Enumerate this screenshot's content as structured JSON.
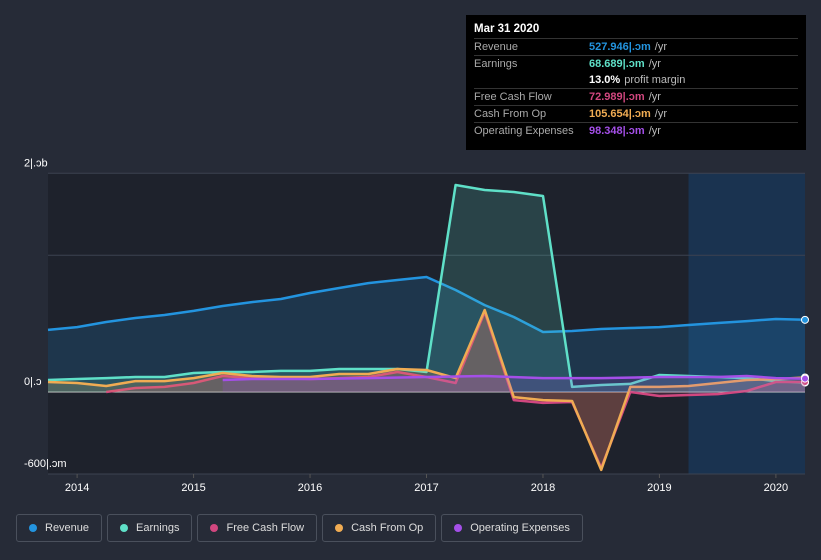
{
  "tooltip": {
    "date": "Mar 31 2020",
    "rows": [
      {
        "label": "Revenue",
        "value": "527.946|.ɔm",
        "unit": "/yr",
        "color": "#2394df"
      },
      {
        "label": "Earnings",
        "value": "68.689|.ɔm",
        "unit": "/yr",
        "color": "#5fe0c8"
      },
      {
        "label": "",
        "value": "13.0%",
        "unit": "profit margin",
        "color": "#ffffff"
      },
      {
        "label": "Free Cash Flow",
        "value": "72.989|.ɔm",
        "unit": "/yr",
        "color": "#d1477f"
      },
      {
        "label": "Cash From Op",
        "value": "105.654|.ɔm",
        "unit": "/yr",
        "color": "#f0ac53"
      },
      {
        "label": "Operating Expenses",
        "value": "98.348|.ɔm",
        "unit": "/yr",
        "color": "#a44fe8"
      }
    ]
  },
  "chart_data": {
    "type": "area",
    "ylim": [
      -600,
      1600
    ],
    "xlim": [
      2013.75,
      2020.25
    ],
    "forecast_region_start": 2019.25,
    "y_ticks": [
      {
        "value": 1600,
        "label": "2|.ɔb"
      },
      {
        "value": 1000,
        "label": ""
      },
      {
        "value": 0,
        "label": "0|.ɔ"
      },
      {
        "value": -600,
        "label": "-600|.ɔm"
      }
    ],
    "x_ticks": [
      2014,
      2015,
      2016,
      2017,
      2018,
      2019,
      2020
    ],
    "x_tick_labels": [
      "2014",
      "2015",
      "2016",
      "2017",
      "2018",
      "2019",
      "2020"
    ],
    "series": [
      {
        "name": "Revenue",
        "color": "#2394df",
        "x": [
          2013.75,
          2014,
          2014.25,
          2014.5,
          2014.75,
          2015,
          2015.25,
          2015.5,
          2015.75,
          2016,
          2016.25,
          2016.5,
          2016.75,
          2017,
          2017.25,
          2017.5,
          2017.75,
          2018,
          2018.25,
          2018.5,
          2018.75,
          2019,
          2019.25,
          2019.5,
          2019.75,
          2020,
          2020.25
        ],
        "values": [
          454,
          475,
          512,
          541,
          563,
          593,
          629,
          658,
          680,
          724,
          761,
          797,
          819,
          841,
          746,
          636,
          549,
          439,
          446,
          461,
          468,
          475,
          490,
          505,
          519,
          534,
          528
        ]
      },
      {
        "name": "Earnings",
        "color": "#5fe0c8",
        "x": [
          2013.75,
          2014,
          2014.25,
          2014.5,
          2014.75,
          2015,
          2015.25,
          2015.5,
          2015.75,
          2016,
          2016.25,
          2016.5,
          2016.75,
          2017,
          2017.25,
          2017.5,
          2017.75,
          2018,
          2018.25,
          2018.5,
          2018.75,
          2019,
          2019.25,
          2019.5,
          2019.75,
          2020,
          2020.25
        ],
        "values": [
          88,
          95,
          102,
          110,
          110,
          139,
          146,
          146,
          154,
          154,
          168,
          168,
          168,
          146,
          1514,
          1478,
          1463,
          1434,
          37,
          51,
          59,
          124,
          117,
          110,
          102,
          80,
          69
        ]
      },
      {
        "name": "Free Cash Flow",
        "color": "#d1477f",
        "x": [
          2014.25,
          2014.5,
          2014.75,
          2015,
          2015.25,
          2015.5,
          2015.75,
          2016,
          2016.25,
          2016.5,
          2016.75,
          2017,
          2017.25,
          2017.5,
          2017.75,
          2018,
          2018.25,
          2018.5,
          2018.75,
          2019,
          2019.25,
          2019.5,
          2019.75,
          2020,
          2020.25
        ],
        "values": [
          0,
          29,
          37,
          66,
          117,
          102,
          102,
          95,
          102,
          110,
          146,
          110,
          66,
          585,
          -59,
          -80,
          -73,
          -556,
          0,
          -29,
          -22,
          -15,
          7,
          73,
          73
        ]
      },
      {
        "name": "Cash From Op",
        "color": "#f0ac53",
        "x": [
          2013.75,
          2014,
          2014.25,
          2014.5,
          2014.75,
          2015,
          2015.25,
          2015.5,
          2015.75,
          2016,
          2016.25,
          2016.5,
          2016.75,
          2017,
          2017.25,
          2017.5,
          2017.75,
          2018,
          2018.25,
          2018.5,
          2018.75,
          2019,
          2019.25,
          2019.5,
          2019.75,
          2020,
          2020.25
        ],
        "values": [
          73,
          66,
          44,
          80,
          80,
          102,
          139,
          117,
          110,
          110,
          132,
          132,
          168,
          161,
          102,
          600,
          -37,
          -59,
          -66,
          -570,
          37,
          37,
          44,
          66,
          88,
          95,
          106
        ]
      },
      {
        "name": "Operating Expenses",
        "color": "#a44fe8",
        "x": [
          2015.25,
          2015.5,
          2016,
          2016.5,
          2017,
          2017.5,
          2018,
          2018.5,
          2019,
          2019.5,
          2019.75,
          2020,
          2020.25
        ],
        "values": [
          88,
          95,
          95,
          102,
          110,
          117,
          102,
          102,
          110,
          110,
          117,
          102,
          98
        ]
      }
    ]
  }
}
